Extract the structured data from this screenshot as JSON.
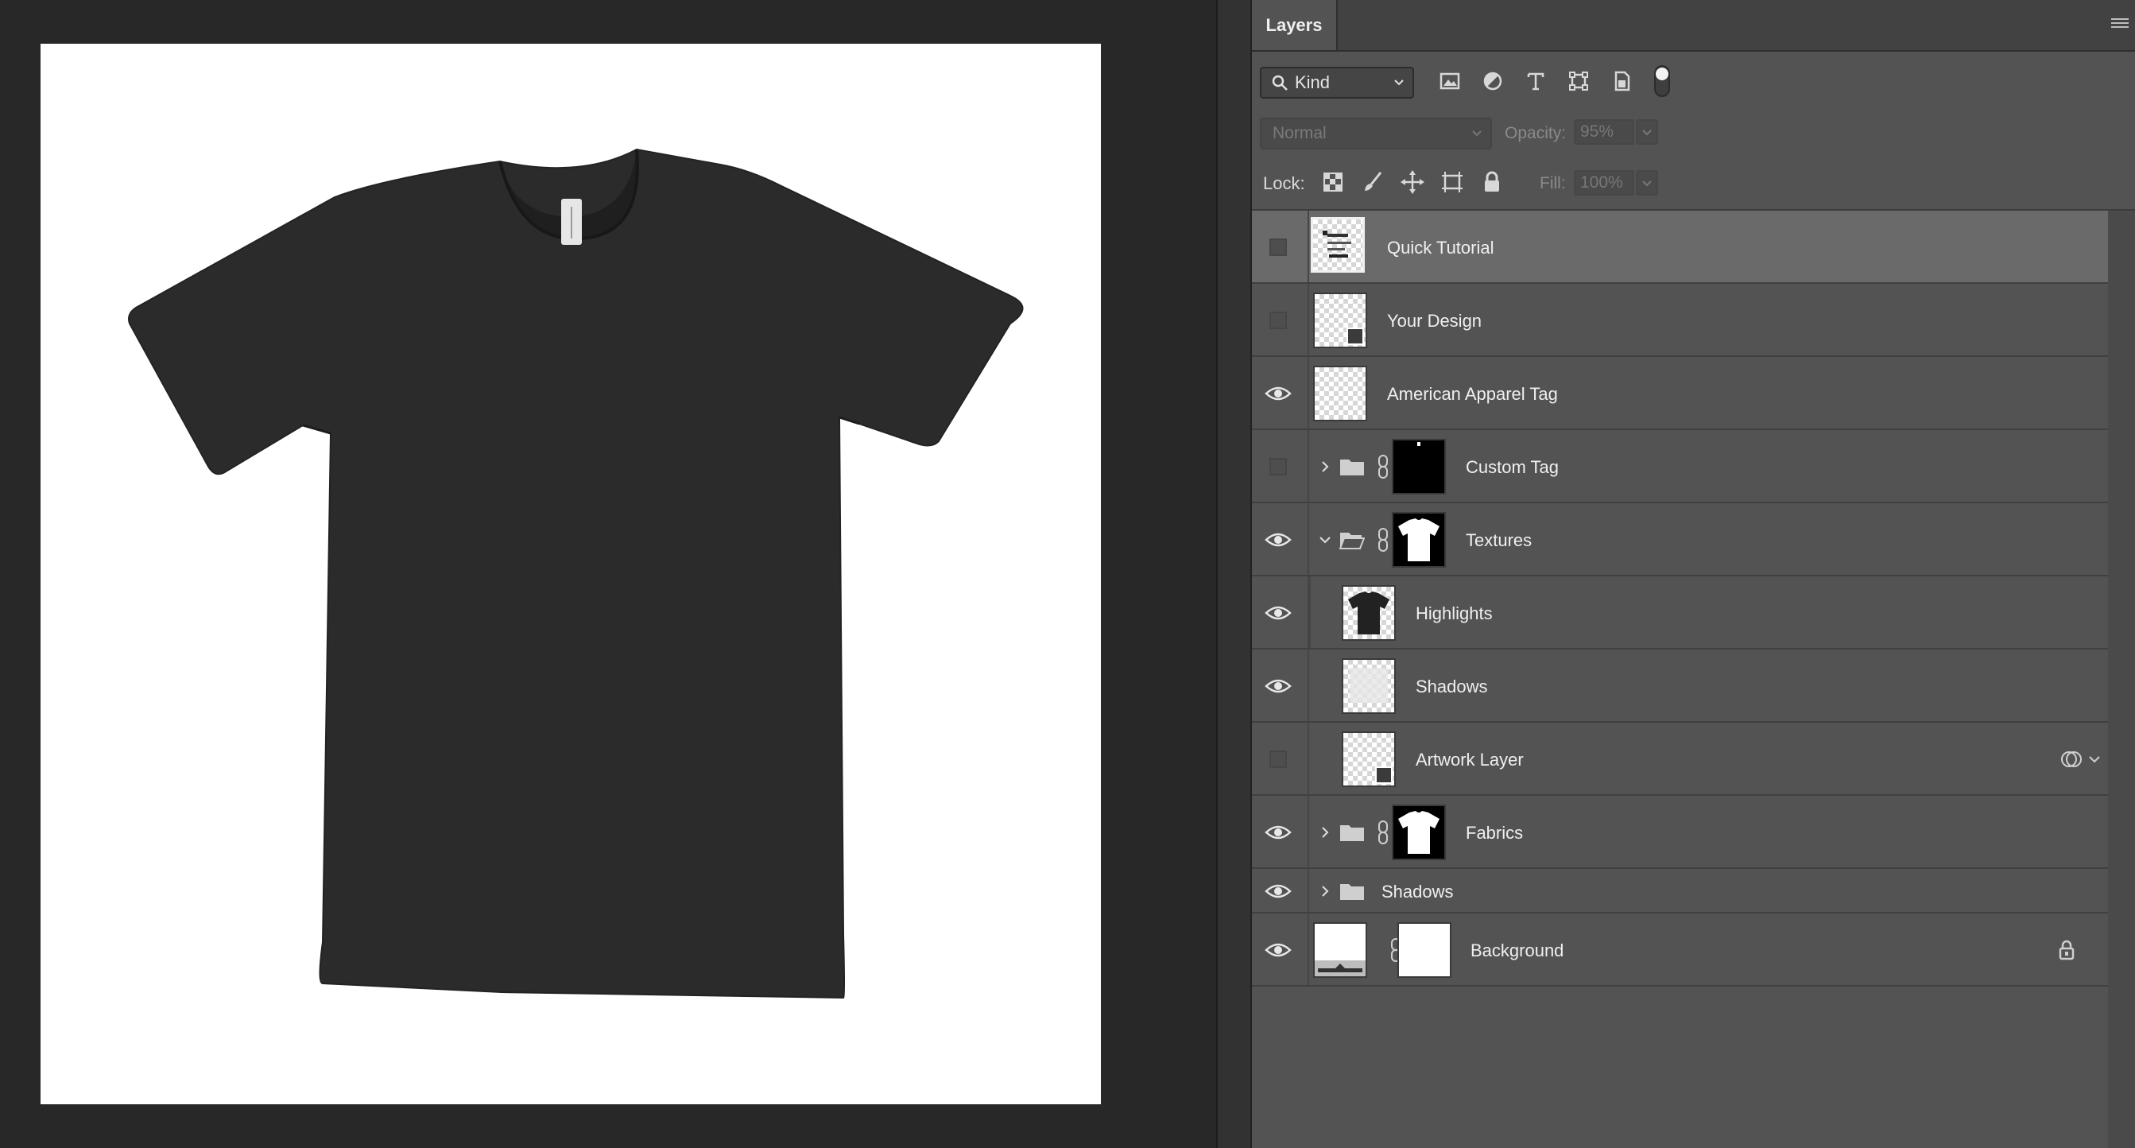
{
  "panel": {
    "tab_label": "Layers",
    "filter": {
      "kind_label": "Kind"
    },
    "blend": {
      "mode": "Normal",
      "opacity_label": "Opacity:",
      "opacity_value": "95%"
    },
    "lock": {
      "label": "Lock:",
      "fill_label": "Fill:",
      "fill_value": "100%"
    }
  },
  "layers": [
    {
      "name": "Quick Tutorial",
      "visible": false,
      "selected": true,
      "type": "layer"
    },
    {
      "name": "Your Design",
      "visible": false,
      "type": "smart-object"
    },
    {
      "name": "American Apparel Tag",
      "visible": true,
      "type": "layer"
    },
    {
      "name": "Custom Tag",
      "visible": false,
      "type": "group",
      "expanded": false
    },
    {
      "name": "Textures",
      "visible": true,
      "type": "group",
      "expanded": true
    },
    {
      "name": "Highlights",
      "visible": true,
      "type": "layer"
    },
    {
      "name": "Shadows",
      "visible": true,
      "type": "layer"
    },
    {
      "name": "Artwork Layer",
      "visible": false,
      "type": "smart-object"
    },
    {
      "name": "Fabrics",
      "visible": true,
      "type": "group",
      "expanded": false
    },
    {
      "name": "Shadows",
      "visible": true,
      "type": "group",
      "expanded": false
    },
    {
      "name": "Background",
      "visible": true,
      "type": "layer",
      "locked": true
    }
  ],
  "canvas": {
    "background_color": "#ffffff",
    "shirt_color": "#2b2b2b"
  },
  "colors": {
    "workspace": "#282828",
    "panel": "#535353",
    "selected_row": "#6a6a6a"
  }
}
